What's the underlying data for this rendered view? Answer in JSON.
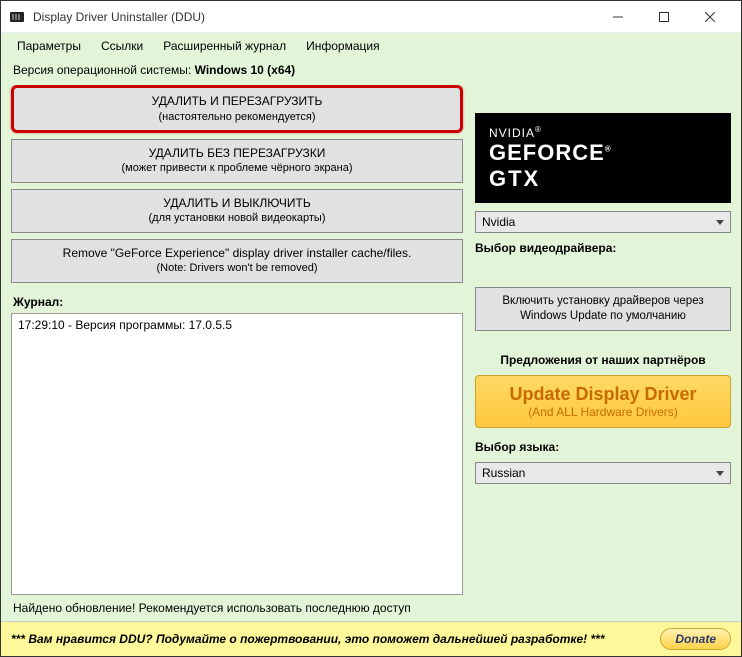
{
  "window": {
    "title": "Display Driver Uninstaller (DDU)"
  },
  "menu": {
    "items": [
      "Параметры",
      "Ссылки",
      "Расширенный журнал",
      "Информация"
    ]
  },
  "osVersion": {
    "label": "Версия операционной системы:",
    "value": "Windows 10 (x64)"
  },
  "actions": {
    "btn1_line1": "УДАЛИТЬ И ПЕРЕЗАГРУЗИТЬ",
    "btn1_line2": "(настоятельно рекомендуется)",
    "btn2_line1": "УДАЛИТЬ БЕЗ ПЕРЕЗАГРУЗКИ",
    "btn2_line2": "(может привести к проблеме чёрного экрана)",
    "btn3_line1": "УДАЛИТЬ И ВЫКЛЮЧИТЬ",
    "btn3_line2": "(для установки новой видеокарты)",
    "btn4_line1": "Remove \"GeForce Experience\" display driver installer cache/files.",
    "btn4_line2": "(Note: Drivers won't be removed)"
  },
  "log": {
    "label": "Журнал:",
    "entry": "17:29:10 - Версия программы: 17.0.5.5"
  },
  "gpu": {
    "brand_l1": "NVIDIA",
    "brand_l2": "GEFORCE",
    "brand_l3": "GTX",
    "vendorSelected": "Nvidia",
    "driverLabel": "Выбор видеодрайвера:"
  },
  "wuButton": {
    "line1": "Включить установку драйверов через",
    "line2": "Windows Update по умолчанию"
  },
  "partners": {
    "label": "Предложения от наших партнёров",
    "btn_line1": "Update Display Driver",
    "btn_line2": "(And ALL Hardware Drivers)"
  },
  "language": {
    "label": "Выбор языка:",
    "selected": "Russian"
  },
  "status": "Найдено обновление! Рекомендуется использовать последнюю доступ",
  "donate": {
    "text": "*** Вам нравится DDU? Подумайте о пожертвовании, это поможет дальнейшей разработке! ***",
    "button": "Donate"
  }
}
